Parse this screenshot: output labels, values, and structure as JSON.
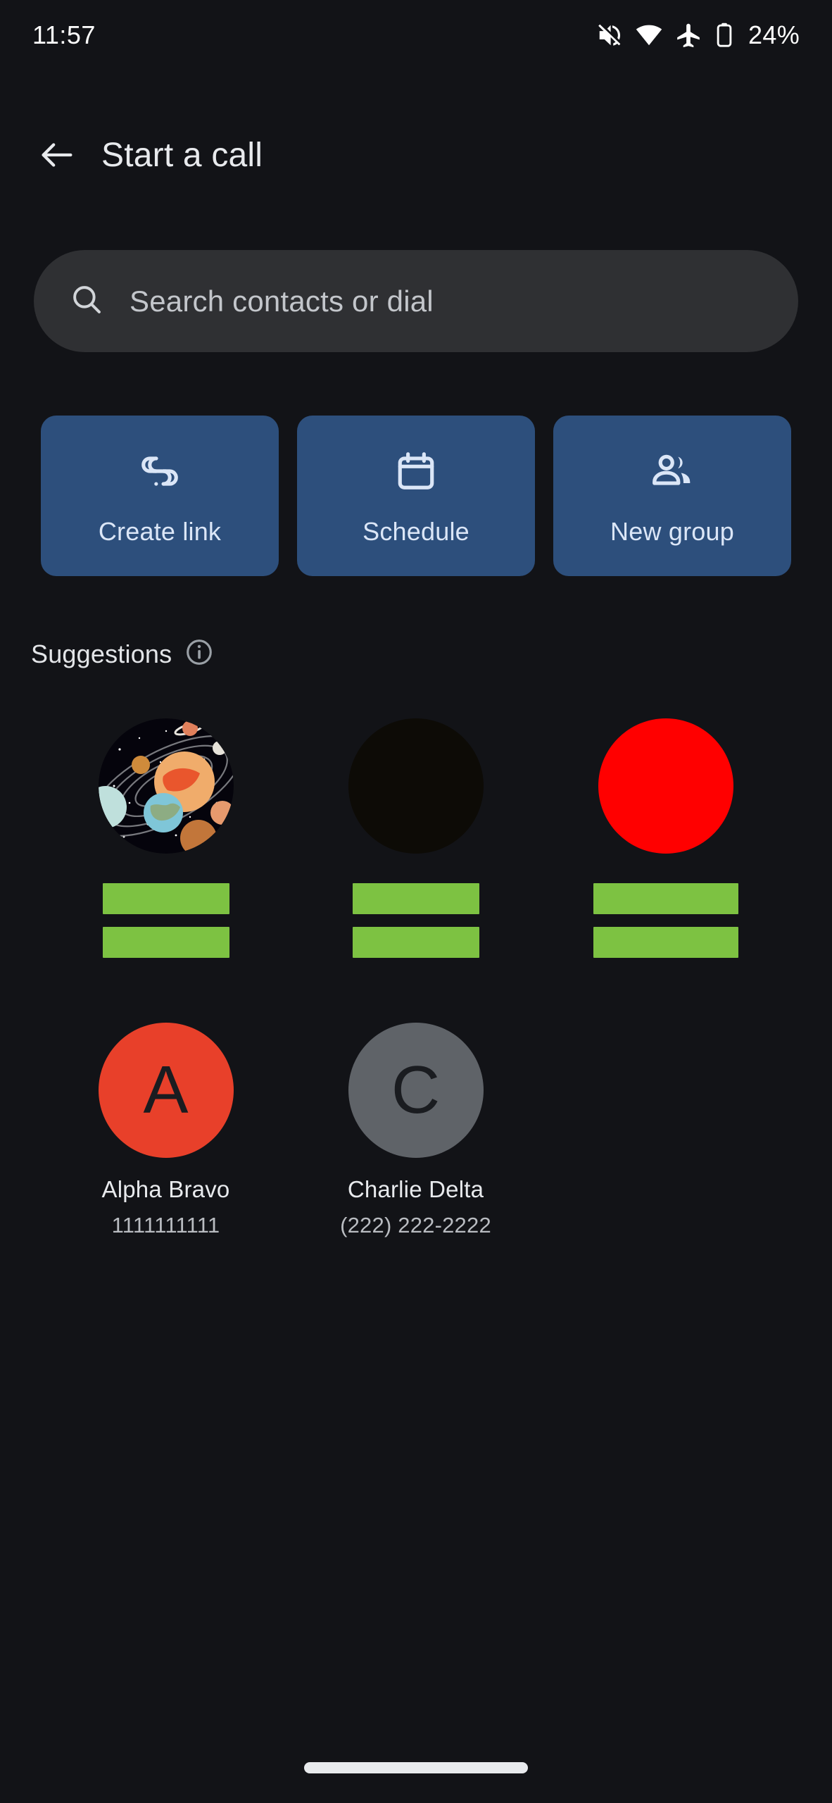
{
  "status_bar": {
    "time": "11:57",
    "battery_percent": "24%",
    "icons": [
      "mute-icon",
      "wifi-icon",
      "airplane-mode-icon",
      "battery-icon"
    ]
  },
  "app_bar": {
    "back_icon": "arrow-back-icon",
    "title": "Start a call"
  },
  "search": {
    "icon": "search-icon",
    "placeholder": "Search contacts or dial",
    "value": ""
  },
  "action_cards": [
    {
      "label": "Create link",
      "icon": "link-icon"
    },
    {
      "label": "Schedule",
      "icon": "calendar-icon"
    },
    {
      "label": "New group",
      "icon": "people-icon"
    }
  ],
  "suggestions": {
    "title": "Suggestions",
    "info_icon": "info-icon",
    "items": [
      {
        "avatar_type": "image",
        "avatar_desc": "solar-system-illustration",
        "name_redacted": true,
        "sub_redacted": true,
        "name": "",
        "sub": ""
      },
      {
        "avatar_type": "image",
        "avatar_desc": "dark-photo",
        "avatar_color": "#0d0b06",
        "name_redacted": true,
        "sub_redacted": true,
        "name": "",
        "sub": ""
      },
      {
        "avatar_type": "color",
        "avatar_color": "#ff0000",
        "name_redacted": true,
        "sub_redacted": true,
        "name": "",
        "sub": ""
      },
      {
        "avatar_type": "initial",
        "avatar_color": "#e8402a",
        "initial": "A",
        "name_redacted": false,
        "sub_redacted": false,
        "name": "Alpha Bravo",
        "sub": "1111111111"
      },
      {
        "avatar_type": "initial",
        "avatar_color": "#5f6368",
        "initial": "C",
        "name_redacted": false,
        "sub_redacted": false,
        "name": "Charlie Delta",
        "sub": "(222) 222-2222"
      }
    ]
  },
  "nav": {
    "pill": "home-gesture-pill"
  },
  "colors": {
    "background": "#121317",
    "card_blue": "#2d4f7c",
    "search_bg": "#2f3033",
    "redaction_green": "#7dc242",
    "text_primary": "#e8eaed",
    "text_secondary": "#b9bcc1"
  }
}
